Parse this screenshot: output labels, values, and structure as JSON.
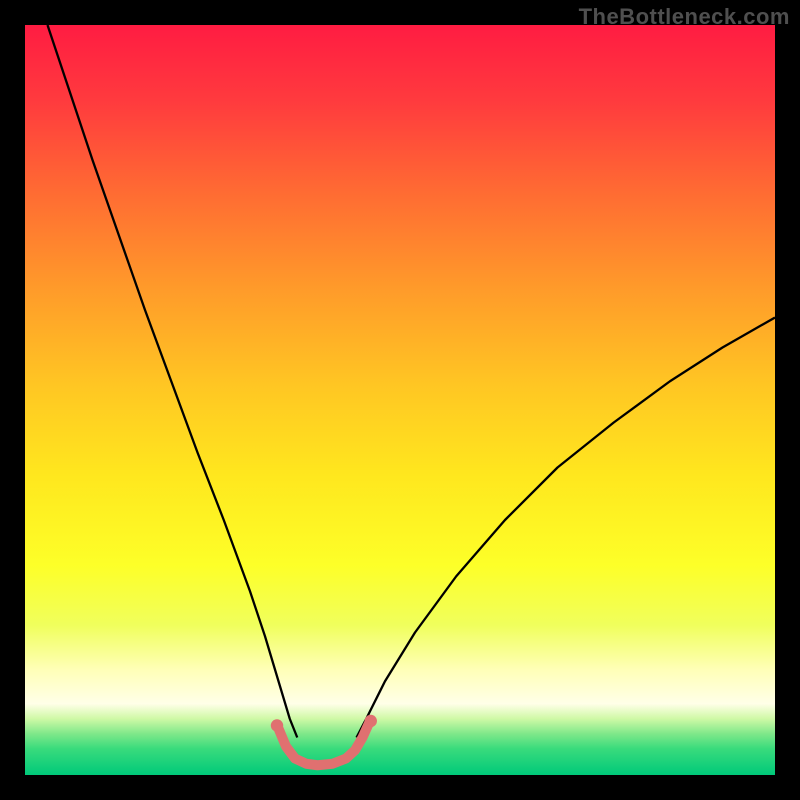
{
  "watermark": "TheBottleneck.com",
  "chart_data": {
    "type": "line",
    "title": "",
    "xlabel": "",
    "ylabel": "",
    "xlim": [
      0,
      100
    ],
    "ylim": [
      0,
      100
    ],
    "grid": false,
    "legend": false,
    "gradient_stops": [
      {
        "offset": 0.0,
        "color": "#ff1c42"
      },
      {
        "offset": 0.1,
        "color": "#ff3a3e"
      },
      {
        "offset": 0.22,
        "color": "#ff6a33"
      },
      {
        "offset": 0.35,
        "color": "#ff9a2a"
      },
      {
        "offset": 0.48,
        "color": "#ffc623"
      },
      {
        "offset": 0.6,
        "color": "#ffe71e"
      },
      {
        "offset": 0.72,
        "color": "#fdff28"
      },
      {
        "offset": 0.8,
        "color": "#f0ff5c"
      },
      {
        "offset": 0.86,
        "color": "#ffffb8"
      },
      {
        "offset": 0.905,
        "color": "#ffffe8"
      },
      {
        "offset": 0.925,
        "color": "#cff9a6"
      },
      {
        "offset": 0.945,
        "color": "#7fe88a"
      },
      {
        "offset": 0.965,
        "color": "#39db7c"
      },
      {
        "offset": 1.0,
        "color": "#00c97a"
      }
    ],
    "series": [
      {
        "name": "curve-left",
        "stroke": "#000000",
        "stroke_width": 2.3,
        "x": [
          3.0,
          6.0,
          9.0,
          12.5,
          16.0,
          19.5,
          23.0,
          26.5,
          30.0,
          32.0,
          33.8,
          35.3,
          36.3
        ],
        "y": [
          100.0,
          91.0,
          82.0,
          72.0,
          62.0,
          52.5,
          43.0,
          34.0,
          24.5,
          18.5,
          12.5,
          7.5,
          5.0
        ]
      },
      {
        "name": "curve-right",
        "stroke": "#000000",
        "stroke_width": 2.3,
        "x": [
          44.2,
          45.5,
          48.0,
          52.0,
          57.5,
          64.0,
          71.0,
          78.5,
          86.0,
          93.0,
          100.0
        ],
        "y": [
          5.0,
          7.5,
          12.5,
          19.0,
          26.5,
          34.0,
          41.0,
          47.0,
          52.5,
          57.0,
          61.0
        ]
      },
      {
        "name": "trough-salmon",
        "stroke": "#e07070",
        "stroke_width": 10.0,
        "linecap": "round",
        "x": [
          33.8,
          34.8,
          36.0,
          37.5,
          39.0,
          41.0,
          42.8,
          44.0,
          45.0,
          45.9
        ],
        "y": [
          6.2,
          3.8,
          2.2,
          1.5,
          1.3,
          1.5,
          2.2,
          3.3,
          5.0,
          7.0
        ]
      }
    ],
    "trough_marker": {
      "color": "#e07070",
      "endpoints": [
        {
          "x": 33.6,
          "y": 6.6,
          "r": 6.2
        },
        {
          "x": 46.1,
          "y": 7.2,
          "r": 6.2
        }
      ]
    }
  }
}
